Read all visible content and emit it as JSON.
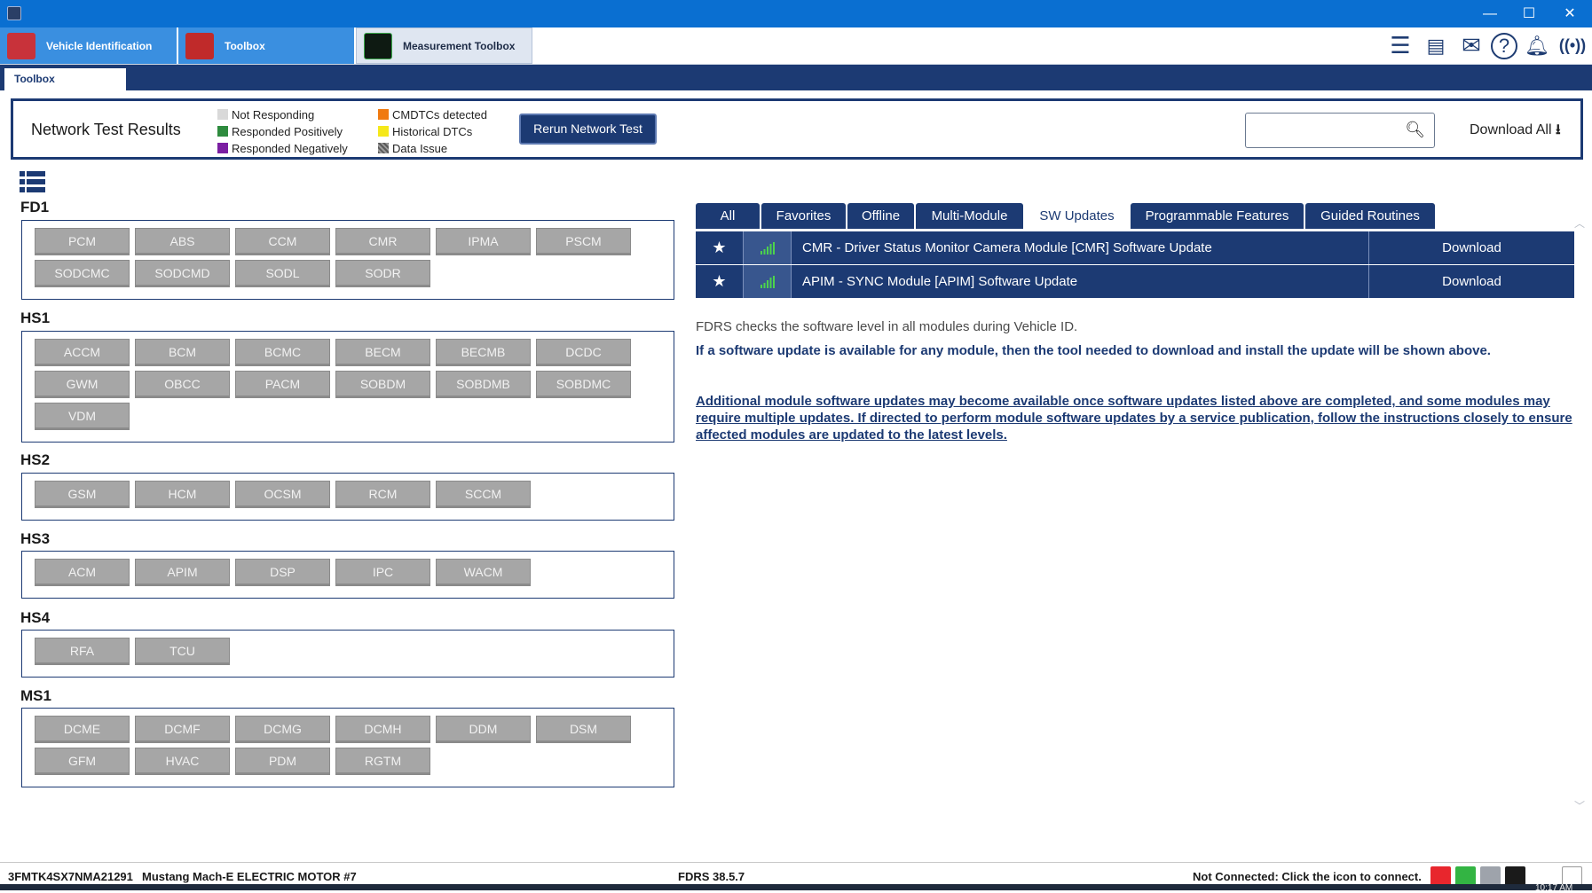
{
  "window": {
    "minimize_glyph": "—",
    "maximize_glyph": "☐",
    "close_glyph": "✕"
  },
  "top_tabs": [
    {
      "label": "Vehicle Identification",
      "icon": "car-icon"
    },
    {
      "label": "Toolbox",
      "icon": "toolbox-icon"
    },
    {
      "label": "Measurement Toolbox",
      "icon": "oscilloscope-icon"
    }
  ],
  "toolbar_icons": [
    "menu-icon",
    "printer-icon",
    "mail-icon",
    "help-icon",
    "bell-icon",
    "wireless-icon"
  ],
  "sub_tab": "Toolbox",
  "network_test": {
    "title": "Network Test Results",
    "legend_left": [
      {
        "label": "Not Responding",
        "color": "#d9d9d9"
      },
      {
        "label": "Responded Positively",
        "color": "#2e8b3e"
      },
      {
        "label": "Responded Negatively",
        "color": "#7b1fa2"
      }
    ],
    "legend_right": [
      {
        "label": "CMDTCs detected",
        "color": "#f07a10"
      },
      {
        "label": "Historical DTCs",
        "color": "#f5e81a"
      },
      {
        "label": "Data Issue",
        "color": "#7a7a7a"
      }
    ],
    "rerun_label": "Rerun Network Test",
    "search_value": "",
    "download_all_label": "Download All"
  },
  "groups": [
    {
      "name": "FD1",
      "modules": [
        "PCM",
        "ABS",
        "CCM",
        "CMR",
        "IPMA",
        "PSCM",
        "SODCMC",
        "SODCMD",
        "SODL",
        "SODR"
      ]
    },
    {
      "name": "HS1",
      "modules": [
        "ACCM",
        "BCM",
        "BCMC",
        "BECM",
        "BECMB",
        "DCDC",
        "GWM",
        "OBCC",
        "PACM",
        "SOBDM",
        "SOBDMB",
        "SOBDMC",
        "VDM"
      ]
    },
    {
      "name": "HS2",
      "modules": [
        "GSM",
        "HCM",
        "OCSM",
        "RCM",
        "SCCM"
      ]
    },
    {
      "name": "HS3",
      "modules": [
        "ACM",
        "APIM",
        "DSP",
        "IPC",
        "WACM"
      ]
    },
    {
      "name": "HS4",
      "modules": [
        "RFA",
        "TCU"
      ]
    },
    {
      "name": "MS1",
      "modules": [
        "DCME",
        "DCMF",
        "DCMG",
        "DCMH",
        "DDM",
        "DSM",
        "GFM",
        "HVAC",
        "PDM",
        "RGTM"
      ]
    }
  ],
  "category_tabs": [
    "All",
    "Favorites",
    "Offline",
    "Multi-Module",
    "SW Updates",
    "Programmable Features",
    "Guided Routines"
  ],
  "active_category": "SW Updates",
  "updates": [
    {
      "name": "CMR - Driver Status Monitor Camera Module [CMR] Software Update",
      "action": "Download"
    },
    {
      "name": "APIM - SYNC Module [APIM] Software Update",
      "action": "Download"
    }
  ],
  "info": {
    "line1": "FDRS checks the software level in all modules during Vehicle ID.",
    "line2": "If a software update is available for any module, then the tool needed to download and install the update will be shown above.",
    "line3": "Additional module software updates may become available once software updates listed above are completed, and some modules may require multiple updates. If directed to perform module software updates by a service publication, follow the instructions closely to ensure affected modules are updated to the latest levels."
  },
  "status": {
    "vin": "3FMTK4SX7NMA21291",
    "vehicle": "Mustang Mach-E ELECTRIC MOTOR #7",
    "version": "FDRS 38.5.7",
    "connection": "Not Connected: Click the icon to connect.",
    "clock": "10:17 AM"
  }
}
